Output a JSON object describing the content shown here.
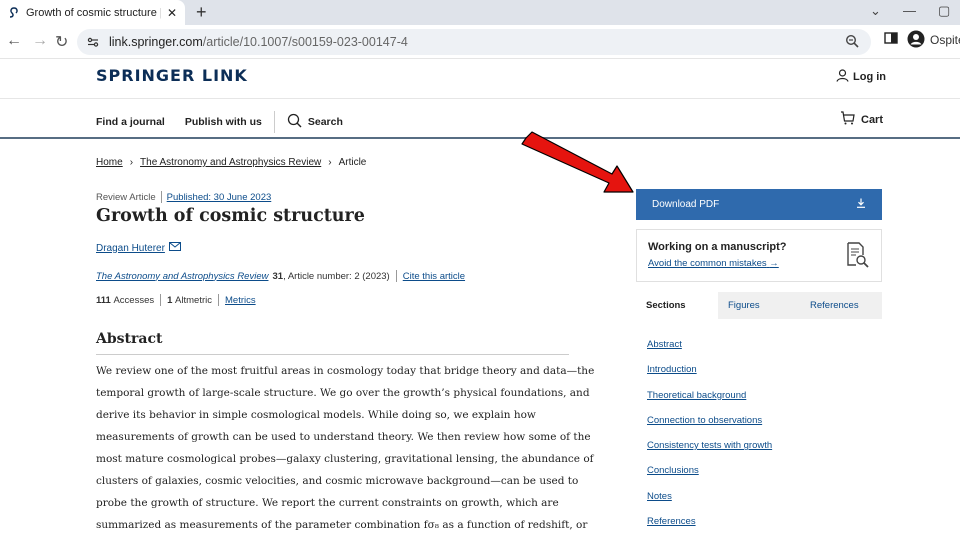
{
  "browser": {
    "tab_title": "Growth of cosmic structure | Spri",
    "url_host": "link.springer.com",
    "url_path": "/article/10.1007/s00159-023-00147-4",
    "profile_label": "Ospite"
  },
  "header": {
    "logo": "SPRINGER LINK",
    "login": "Log in",
    "nav": [
      "Find a journal",
      "Publish with us"
    ],
    "search": "Search",
    "cart": "Cart"
  },
  "breadcrumb": {
    "home": "Home",
    "journal": "The Astronomy and Astrophysics Review",
    "current": "Article"
  },
  "article": {
    "type": "Review Article",
    "published": "Published: 30 June 2023",
    "title": "Growth of cosmic structure",
    "author": "Dragan Huterer",
    "journal": "The Astronomy and Astrophysics Review",
    "volume": "31",
    "article_number": ", Article number: 2 (2023)",
    "cite": "Cite this article",
    "accesses": "111",
    "accesses_label": "Accesses",
    "altmetric": "1",
    "altmetric_label": "Altmetric",
    "metrics": "Metrics"
  },
  "abstract": {
    "heading": "Abstract",
    "lines": [
      "We review one of the most fruitful areas in cosmology today that bridge theory and data—the",
      "temporal growth of large-scale structure. We go over the growth’s physical foundations, and",
      "derive its behavior in simple cosmological models. While doing so, we explain how",
      "measurements of growth can be used to understand theory. We then review how some of the",
      "most mature cosmological probes—galaxy clustering, gravitational lensing, the abundance of",
      "clusters of galaxies, cosmic velocities, and cosmic microwave background—can be used to",
      "probe the growth of structure. We report the current constraints on growth, which are",
      "summarized as measurements of the parameter combination fσ₈ as a function of redshift, or"
    ]
  },
  "sidebar": {
    "download": "Download PDF",
    "manu_heading": "Working on a manuscript?",
    "manu_link": "Avoid the common mistakes",
    "tabs": [
      "Sections",
      "Figures",
      "References"
    ],
    "sections": [
      "Abstract",
      "Introduction",
      "Theoretical background",
      "Connection to observations",
      "Consistency tests with growth",
      "Conclusions",
      "Notes",
      "References"
    ]
  },
  "colors": {
    "accent": "#2f6aad",
    "arrow": "#e5140f"
  }
}
